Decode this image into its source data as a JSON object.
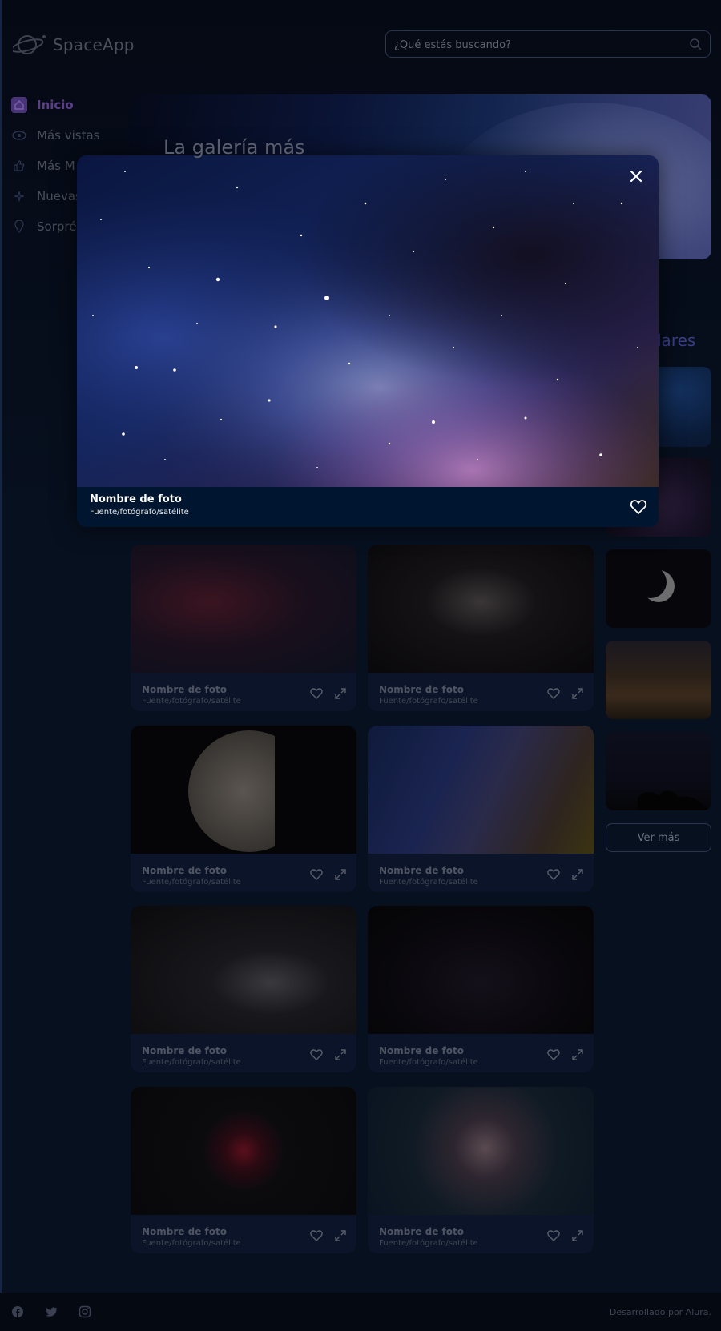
{
  "header": {
    "logo_text": "SpaceApp",
    "search_placeholder": "¿Qué estás buscando?"
  },
  "sidebar": {
    "items": [
      {
        "label": "Inicio",
        "icon": "home-icon",
        "active": true
      },
      {
        "label": "Más vistas",
        "icon": "eye-icon"
      },
      {
        "label": "Más M",
        "icon": "thumbs-up-icon"
      },
      {
        "label": "Nuevas",
        "icon": "sparkle-icon"
      },
      {
        "label": "Sorpré",
        "icon": "map-pin-icon"
      }
    ]
  },
  "banner": {
    "title": "La galería más"
  },
  "popular": {
    "title": "lares",
    "button_label": "Ver más"
  },
  "gallery": {
    "cards": [
      {
        "name": "Nombre de foto",
        "source": "Fuente/fotógrafo/satélite"
      },
      {
        "name": "Nombre de foto",
        "source": "Fuente/fotógrafo/satélite"
      },
      {
        "name": "Nombre de foto",
        "source": "Fuente/fotógrafo/satélite"
      },
      {
        "name": "Nombre de foto",
        "source": "Fuente/fotógrafo/satélite"
      },
      {
        "name": "Nombre de foto",
        "source": "Fuente/fotógrafo/satélite"
      },
      {
        "name": "Nombre de foto",
        "source": "Fuente/fotógrafo/satélite"
      },
      {
        "name": "Nombre de foto",
        "source": "Fuente/fotógrafo/satélite"
      },
      {
        "name": "Nombre de foto",
        "source": "Fuente/fotógrafo/satélite"
      }
    ]
  },
  "modal": {
    "name": "Nombre de foto",
    "source": "Fuente/fotógrafo/satélite"
  },
  "footer": {
    "credits": "Desarrollado por Alura."
  },
  "colors": {
    "background": "#04070f",
    "accent": "#4a3478",
    "modal_footer": "#001630"
  }
}
